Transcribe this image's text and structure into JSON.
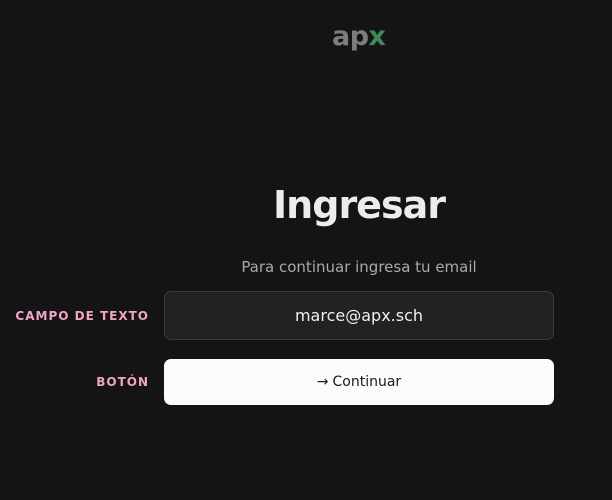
{
  "logo": {
    "part1": "ap",
    "part2": "x",
    "accent_color": "#3f8a5b"
  },
  "login": {
    "title": "Ingresar",
    "subtitle": "Para continuar ingresa tu email",
    "email_value": "marce@apx.sch",
    "button_label": "Continuar",
    "button_icon": "arrow-right-icon"
  },
  "annotations": {
    "field_label": "CAMPO DE TEXTO",
    "button_label": "BOTÓN",
    "color": "#f2a4c8"
  }
}
